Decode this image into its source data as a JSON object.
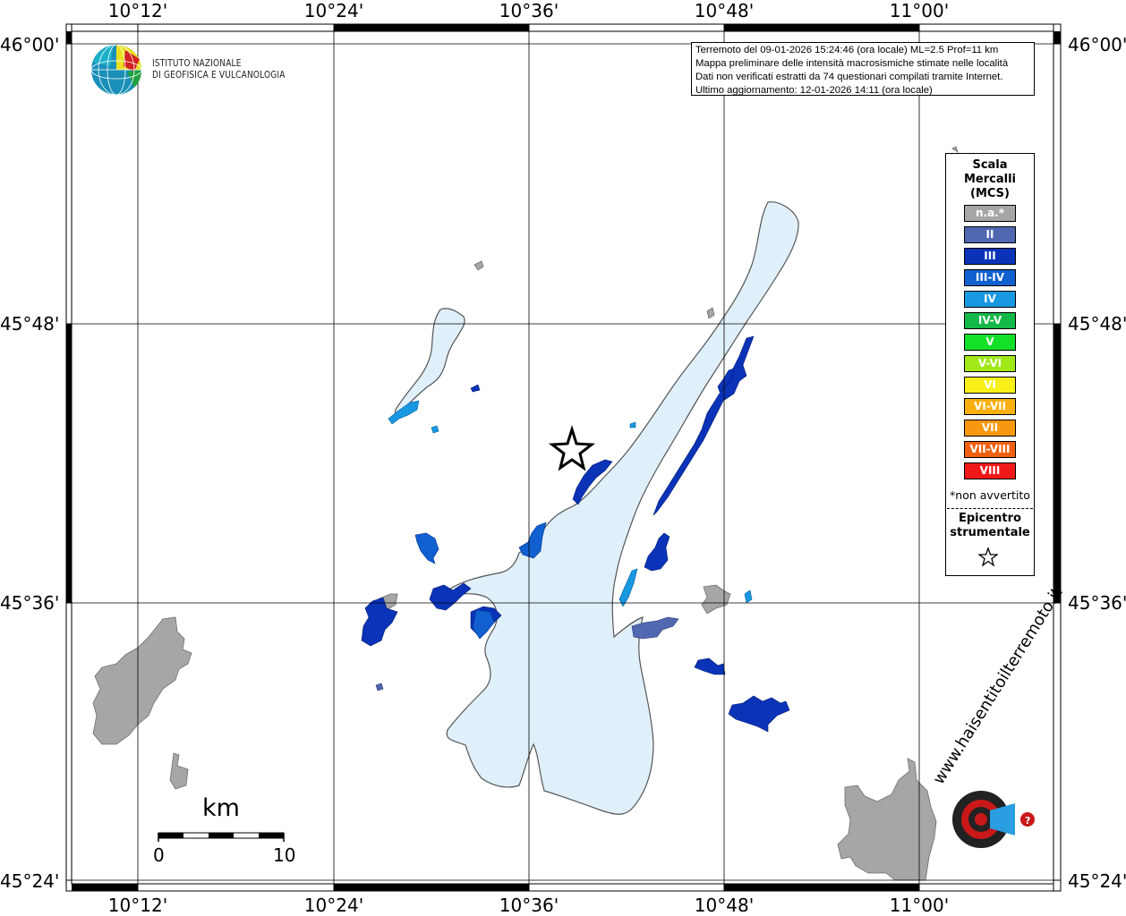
{
  "ticks": {
    "lon": [
      "10°12'",
      "10°24'",
      "10°36'",
      "10°48'",
      "11°00'"
    ],
    "lat": [
      "46°00'",
      "45°48'",
      "45°36'",
      "45°24'"
    ]
  },
  "info": {
    "line1": "Terremoto del 09-01-2026 15:24:46 (ora locale) ML=2.5 Prof=11 km",
    "line2": "Mappa preliminare delle intensità macrosismiche stimate nelle località",
    "line3": "Dati non verificati estratti da 74 questionari compilati tramite Internet.",
    "line4": "Ultimo aggiornamento: 12-01-2026 14:11 (ora locale)"
  },
  "logo": {
    "line1": "ISTITUTO NAZIONALE",
    "line2": "DI GEOFISICA E VULCANOLOGIA"
  },
  "legend": {
    "title1": "Scala",
    "title2": "Mercalli",
    "title3": "(MCS)",
    "items": [
      {
        "label": "n.a.*",
        "color": "#a6a6a6"
      },
      {
        "label": "II",
        "color": "#5068b0"
      },
      {
        "label": "III",
        "color": "#0a33b8"
      },
      {
        "label": "III-IV",
        "color": "#1060d0"
      },
      {
        "label": "IV",
        "color": "#1898e0"
      },
      {
        "label": "IV-V",
        "color": "#14b848"
      },
      {
        "label": "V",
        "color": "#14e028"
      },
      {
        "label": "V-VI",
        "color": "#a0e818"
      },
      {
        "label": "VI",
        "color": "#f8f018"
      },
      {
        "label": "VI-VII",
        "color": "#f8b010"
      },
      {
        "label": "VII",
        "color": "#f89810"
      },
      {
        "label": "VII-VIII",
        "color": "#f06010"
      },
      {
        "label": "VIII",
        "color": "#f01818"
      }
    ],
    "note": "*non avvertito",
    "epi_title1": "Epicentro",
    "epi_title2": "strumentale"
  },
  "scale_bar": {
    "unit": "km",
    "min": "0",
    "max": "10"
  },
  "watermark": {
    "text": "www.haisentitoilterremoto.it"
  },
  "colors": {
    "lake": "#e0f0fa",
    "unavailable": "#a6a6a6",
    "intensity_II": "#5068b0",
    "intensity_III": "#0a33b8",
    "intensity_IV": "#1898e0"
  }
}
